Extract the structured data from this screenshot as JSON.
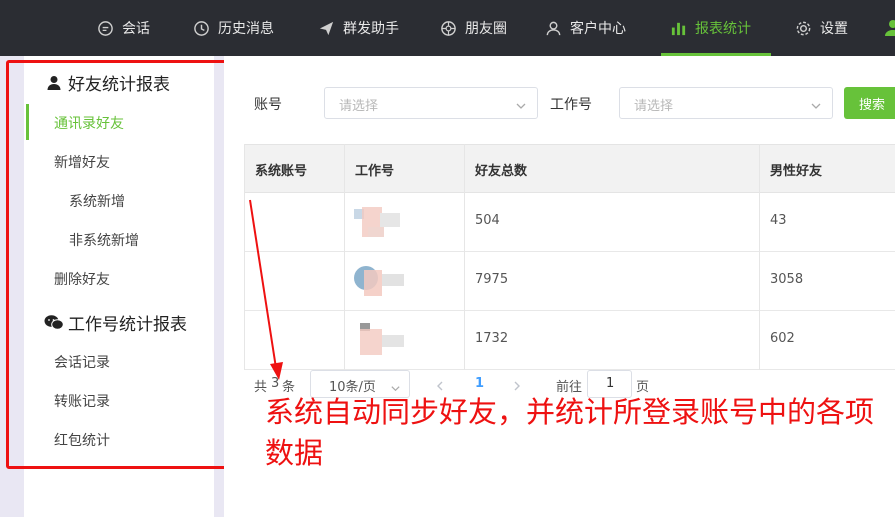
{
  "nav": {
    "items": [
      {
        "label": "会话",
        "icon": "chat-icon"
      },
      {
        "label": "历史消息",
        "icon": "clock-icon"
      },
      {
        "label": "群发助手",
        "icon": "send-icon"
      },
      {
        "label": "朋友圈",
        "icon": "aperture-icon"
      },
      {
        "label": "客户中心",
        "icon": "user-icon"
      },
      {
        "label": "报表统计",
        "icon": "bar-chart-icon",
        "active": true
      },
      {
        "label": "设置",
        "icon": "gear-icon"
      }
    ],
    "accent": "#67c23a"
  },
  "sidebar": {
    "section1": {
      "title": "好友统计报表",
      "icon": "person-icon"
    },
    "items1": [
      "通讯录好友",
      "新增好友",
      "系统新增",
      "非系统新增",
      "删除好友"
    ],
    "section2": {
      "title": "工作号统计报表",
      "icon": "wechat-icon"
    },
    "items2": [
      "会话记录",
      "转账记录",
      "红包统计"
    ]
  },
  "filters": {
    "account_label": "账号",
    "account_placeholder": "请选择",
    "work_label": "工作号",
    "work_placeholder": "请选择",
    "search_label": "搜索"
  },
  "table": {
    "columns": [
      "系统账号",
      "工作号",
      "好友总数",
      "男性好友"
    ],
    "rows": [
      {
        "system_account": "",
        "work_no": "",
        "total": "504",
        "male": "43"
      },
      {
        "system_account": "",
        "work_no": "",
        "total": "7975",
        "male": "3058"
      },
      {
        "system_account": "",
        "work_no": "",
        "total": "1732",
        "male": "602"
      }
    ]
  },
  "pager": {
    "total_prefix": "共",
    "total_count": "3",
    "total_suffix": "条",
    "page_size": "10条/页",
    "current_page": "1",
    "goto_label": "前往",
    "goto_value": "1",
    "page_unit": "页"
  },
  "annotation": {
    "text": "系统自动同步好友，并统计所登录账号中的各项数据",
    "color": "#ee1111"
  }
}
